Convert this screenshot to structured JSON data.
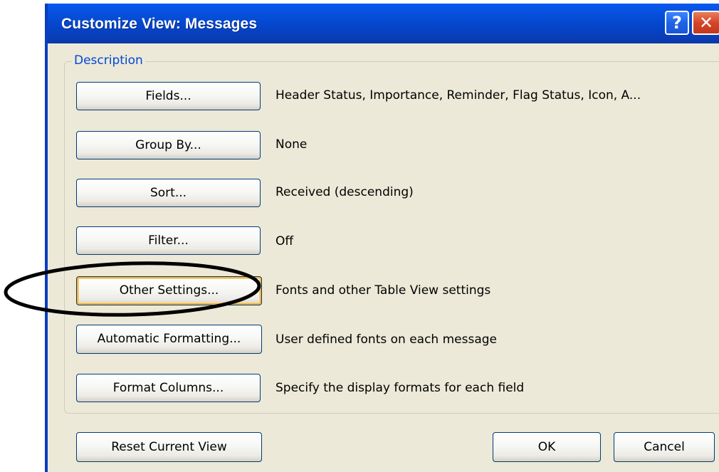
{
  "dialog": {
    "title": "Customize View: Messages",
    "help_glyph": "?",
    "close_glyph": "✕"
  },
  "group": {
    "legend": "Description"
  },
  "rows": [
    {
      "button": "Fields...",
      "description": "Header Status, Importance, Reminder, Flag Status, Icon, A..."
    },
    {
      "button": "Group By...",
      "description": "None"
    },
    {
      "button": "Sort...",
      "description": "Received (descending)"
    },
    {
      "button": "Filter...",
      "description": "Off"
    },
    {
      "button": "Other Settings...",
      "description": "Fonts and other Table View settings"
    },
    {
      "button": "Automatic Formatting...",
      "description": "User defined fonts on each message"
    },
    {
      "button": "Format Columns...",
      "description": "Specify the display formats for each field"
    }
  ],
  "footer": {
    "reset_label": "Reset Current View",
    "ok_label": "OK",
    "cancel_label": "Cancel"
  },
  "annotation": {
    "circled_item": "Other Settings...",
    "color": "#000000"
  },
  "colors": {
    "titlebar": "#0446cc",
    "dialog_bg": "#ece9d8",
    "legend_text": "#0046d5",
    "focus_ring": "#f8b33a",
    "close_button": "#d6442a"
  }
}
